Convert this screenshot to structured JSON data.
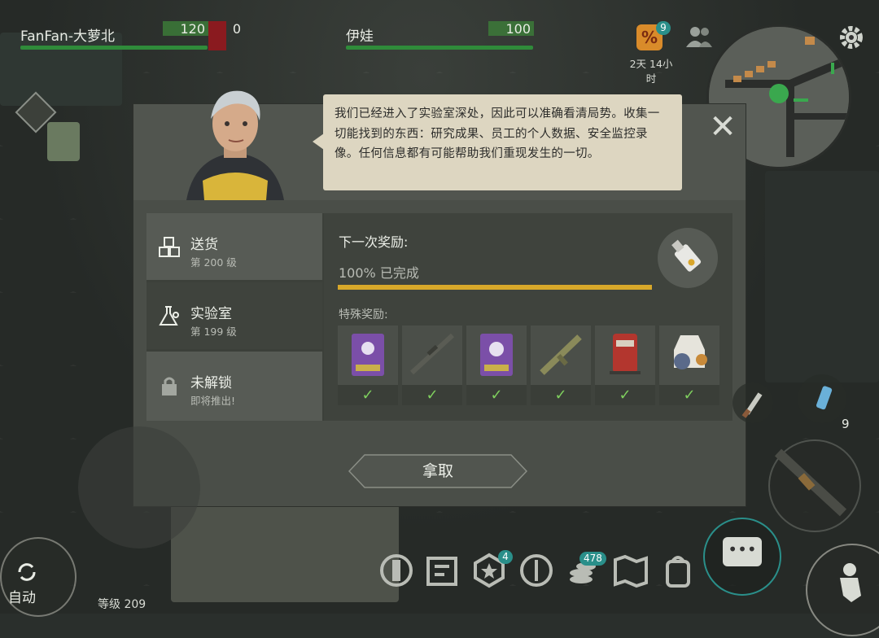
{
  "hud": {
    "player1": {
      "name": "FanFan-大萝北",
      "hp": "120",
      "extra": "0"
    },
    "player2": {
      "name": "伊娃",
      "hp": "100"
    },
    "timer": "2天 14小时",
    "event_badge": "9"
  },
  "dialog": {
    "message": "我们已经进入了实验室深处，因此可以准确看清局势。收集一切能找到的东西：研究成果、员工的个人数据、安全监控录像。任何信息都有可能帮助我们重现发生的一切。",
    "tabs": [
      {
        "label": "送货",
        "sub": "第 200 级"
      },
      {
        "label": "实验室",
        "sub": "第 199 级"
      },
      {
        "label": "未解锁",
        "sub": "即将推出!"
      }
    ],
    "next_reward_label": "下一次奖励:",
    "progress_text": "100% 已完成",
    "progress": 1.0,
    "special_label": "特殊奖励:",
    "special_rewards": [
      {
        "icon": "purple-skull-card-icon",
        "claimed": "✓"
      },
      {
        "icon": "sniper-rifle-icon",
        "claimed": "✓"
      },
      {
        "icon": "purple-bear-card-icon",
        "claimed": "✓"
      },
      {
        "icon": "assault-rifle-icon",
        "claimed": "✓"
      },
      {
        "icon": "red-backpack-icon",
        "claimed": "✓"
      },
      {
        "icon": "armor-vest-icon",
        "claimed": "✓"
      }
    ],
    "take_label": "拿取"
  },
  "bottom": {
    "auto_label": "自动",
    "level_label": "等级 209",
    "badge_4": "4",
    "badge_478": "478",
    "ammo_count": "9"
  },
  "colors": {
    "progress": "#d8a82a",
    "check": "#7fd05e",
    "hp": "#2f8b3a",
    "badge": "#2a8f8a"
  }
}
